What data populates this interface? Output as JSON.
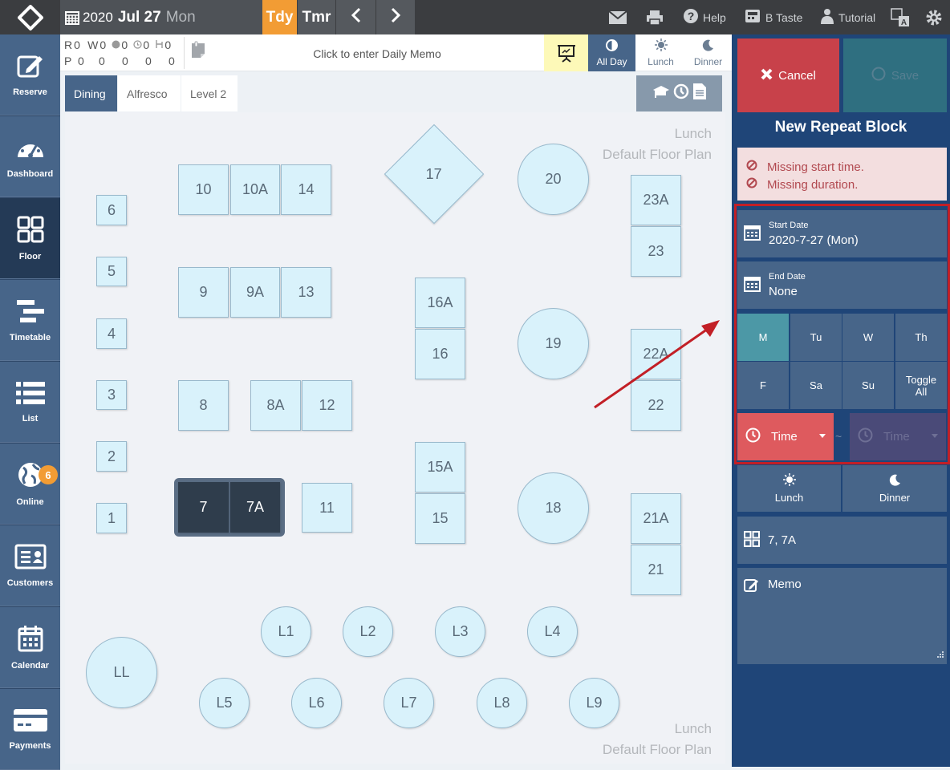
{
  "topbar": {
    "year": "2020",
    "month_day": "Jul 27",
    "weekday": "Mon",
    "today_label": "Tdy",
    "tomorrow_label": "Tmr",
    "help_label": "Help",
    "venue_label": "B Taste",
    "tutorial_label": "Tutorial"
  },
  "sidebar": {
    "items": [
      {
        "label": "Reserve"
      },
      {
        "label": "Dashboard"
      },
      {
        "label": "Floor"
      },
      {
        "label": "Timetable"
      },
      {
        "label": "List"
      },
      {
        "label": "Online",
        "badge": "6"
      },
      {
        "label": "Customers"
      },
      {
        "label": "Calendar"
      },
      {
        "label": "Payments"
      }
    ]
  },
  "counts": {
    "row1": [
      "R",
      "0",
      "W",
      "0",
      "0",
      "0",
      "0"
    ],
    "row2": [
      "P",
      "0",
      "0",
      "0",
      "0",
      "0"
    ]
  },
  "memo": {
    "label": "Click to enter Daily Memo"
  },
  "shifts": {
    "all_day": "All Day",
    "lunch": "Lunch",
    "dinner": "Dinner"
  },
  "tabs": [
    "Dining",
    "Alfresco",
    "Level 2"
  ],
  "floor": {
    "plan_label_shift": "Lunch",
    "plan_label_name": "Default Floor Plan",
    "tables": [
      "10",
      "10A",
      "14",
      "17",
      "20",
      "23A",
      "23",
      "6",
      "5",
      "4",
      "3",
      "2",
      "1",
      "9",
      "9A",
      "13",
      "16A",
      "16",
      "19",
      "22A",
      "22",
      "8",
      "8A",
      "12",
      "15A",
      "15",
      "18",
      "21A",
      "21",
      "7",
      "7A",
      "11",
      "L1",
      "L2",
      "L3",
      "L4",
      "LL",
      "L5",
      "L6",
      "L7",
      "L8",
      "L9"
    ]
  },
  "panel": {
    "cancel_label": "Cancel",
    "save_label": "Save",
    "title": "New Repeat Block",
    "errors": [
      "Missing start time.",
      "Missing duration."
    ],
    "start_date_label": "Start Date",
    "start_date_value": "2020-7-27 (Mon)",
    "end_date_label": "End Date",
    "end_date_value": "None",
    "days": [
      "M",
      "Tu",
      "W",
      "Th",
      "F",
      "Sa",
      "Su",
      "Toggle All"
    ],
    "selected_day": "M",
    "time_start_placeholder": "Time",
    "time_end_placeholder": "Time",
    "time_separator": "~",
    "lunch_label": "Lunch",
    "dinner_label": "Dinner",
    "tables_value": "7, 7A",
    "memo_label": "Memo"
  },
  "colors": {
    "accent_orange": "#f29c34",
    "nav_blue": "#476589",
    "panel_blue": "#1f4578",
    "cancel_red": "#c8414a",
    "error_red": "#b24950",
    "table_fill": "#d9f2fb",
    "highlight_red": "#c21f26"
  }
}
